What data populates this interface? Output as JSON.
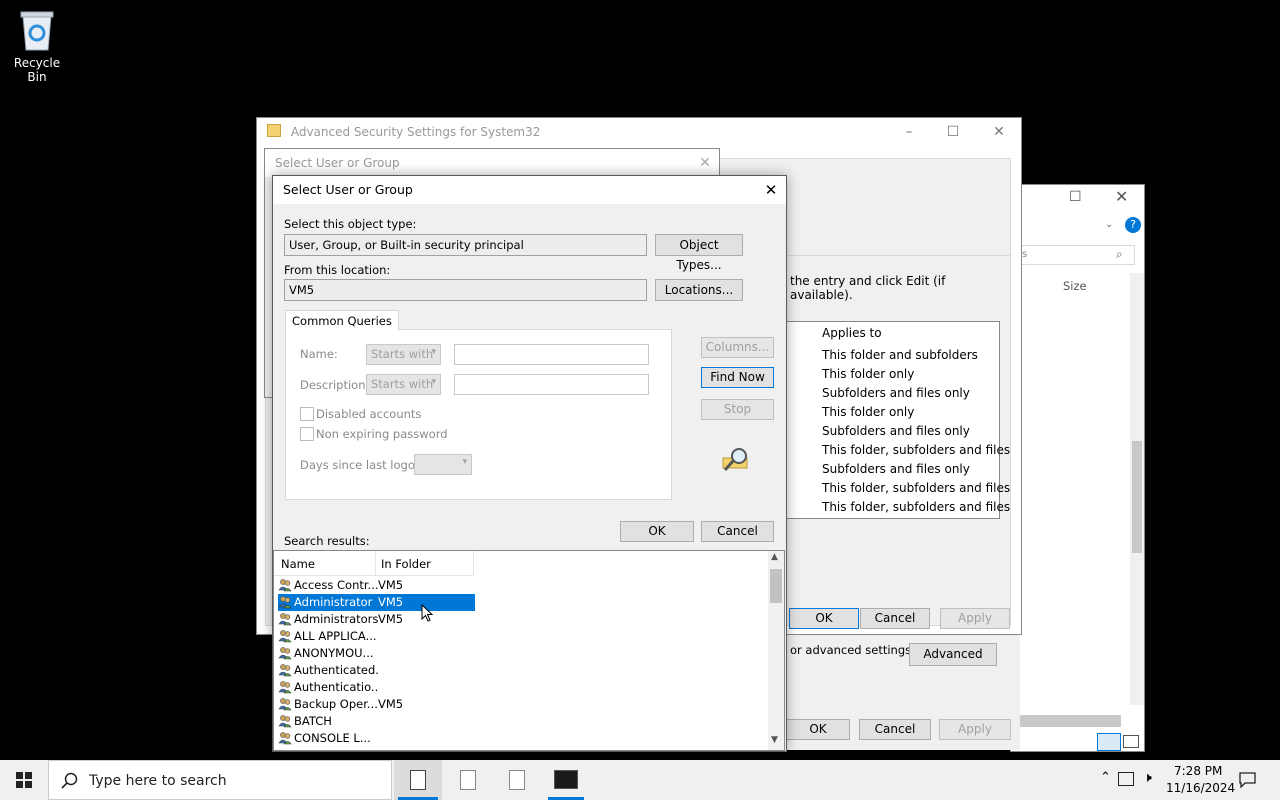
{
  "desktop": {
    "recycle_bin": "Recycle Bin"
  },
  "advanced_window": {
    "title": "Advanced Security Settings for System32",
    "instruction": "the entry and click Edit (if available).",
    "applies_header": "Applies to",
    "applies_to": [
      "This folder and subfolders",
      "This folder only",
      "Subfolders and files only",
      "This folder only",
      "Subfolders and files only",
      "This folder, subfolders and files",
      "Subfolders and files only",
      "This folder, subfolders and files",
      "This folder, subfolders and files"
    ],
    "ok": "OK",
    "cancel": "Cancel",
    "apply": "Apply"
  },
  "props_window": {
    "advanced_text": "or advanced settings,",
    "advanced_btn": "Advanced",
    "ok": "OK",
    "cancel": "Cancel",
    "apply": "Apply"
  },
  "explorer": {
    "size_col": "Size",
    "search_hint": "s"
  },
  "bg_dialog": {
    "title": "Select User or Group"
  },
  "dialog": {
    "title": "Select User or Group",
    "object_type_label": "Select this object type:",
    "object_type_value": "User, Group, or Built-in security principal",
    "object_types_btn": "Object Types...",
    "location_label": "From this location:",
    "location_value": "VM5",
    "locations_btn": "Locations...",
    "tab": "Common Queries",
    "name_label": "Name:",
    "name_op": "Starts with",
    "desc_label": "Description:",
    "desc_op": "Starts with",
    "disabled_accounts": "Disabled accounts",
    "non_expiring": "Non expiring password",
    "days_label": "Days since last logon:",
    "columns_btn": "Columns...",
    "find_now_btn": "Find Now",
    "stop_btn": "Stop",
    "ok": "OK",
    "cancel": "Cancel",
    "results_label": "Search results:",
    "col_name": "Name",
    "col_folder": "In Folder",
    "rows": [
      {
        "name": "Access Contr...",
        "folder": "VM5"
      },
      {
        "name": "Administrator",
        "folder": "VM5"
      },
      {
        "name": "Administrators",
        "folder": "VM5"
      },
      {
        "name": "ALL APPLICA...",
        "folder": ""
      },
      {
        "name": "ANONYMOU...",
        "folder": ""
      },
      {
        "name": "Authenticated...",
        "folder": ""
      },
      {
        "name": "Authenticatio...",
        "folder": ""
      },
      {
        "name": "Backup Oper...",
        "folder": "VM5"
      },
      {
        "name": "BATCH",
        "folder": ""
      },
      {
        "name": "CONSOLE L...",
        "folder": ""
      }
    ]
  },
  "taskbar": {
    "search_placeholder": "Type here to search",
    "time": "7:28 PM",
    "date": "11/16/2024"
  },
  "colors": {
    "accent": "#0078d7",
    "taskbar": "#f0f0f0"
  }
}
